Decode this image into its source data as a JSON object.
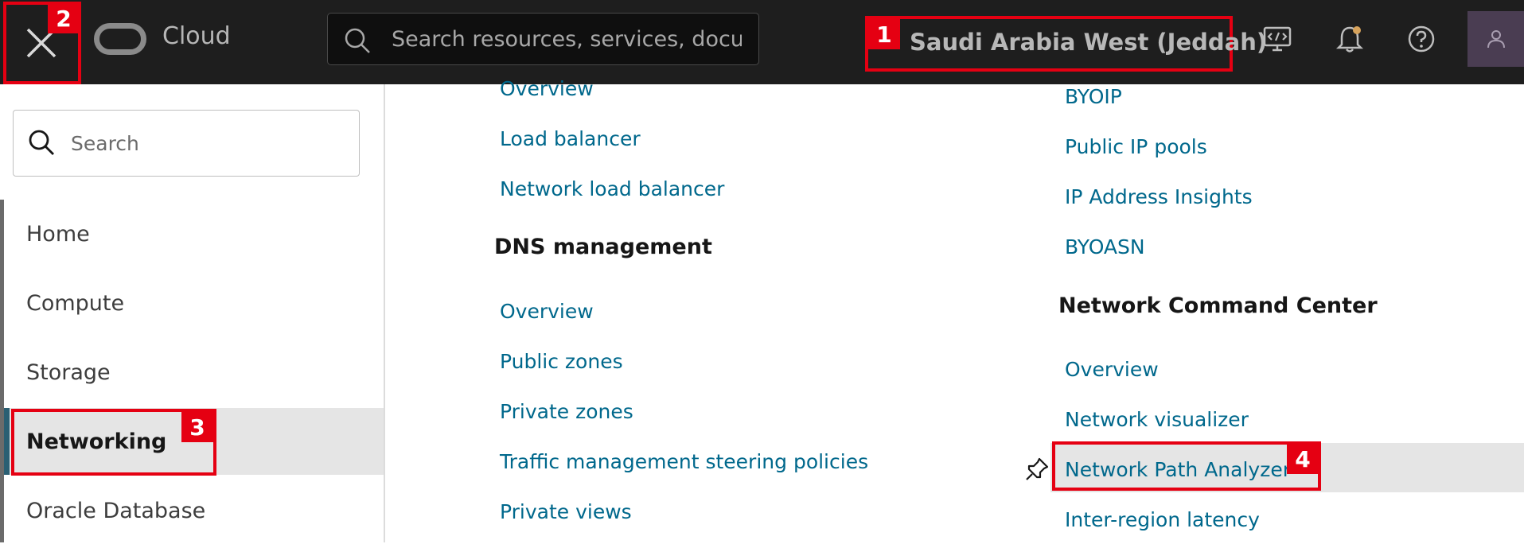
{
  "header": {
    "brand": "Cloud",
    "search_placeholder": "Search resources, services, docur",
    "region": "Saudi Arabia West (Jeddah)"
  },
  "sidebar": {
    "search_placeholder": "Search",
    "items": [
      {
        "label": "Home"
      },
      {
        "label": "Compute"
      },
      {
        "label": "Storage"
      },
      {
        "label": "Networking"
      },
      {
        "label": "Oracle Database"
      }
    ]
  },
  "col1": {
    "links_top": [
      "Overview",
      "Load balancer",
      "Network load balancer"
    ],
    "dns_heading": "DNS management",
    "dns_links": [
      "Overview",
      "Public zones",
      "Private zones",
      "Traffic management steering policies",
      "Private views"
    ]
  },
  "col2": {
    "links_top": [
      "BYOIP",
      "Public IP pools",
      "IP Address Insights",
      "BYOASN"
    ],
    "ncc_heading": "Network Command Center",
    "ncc_links": [
      "Overview",
      "Network visualizer",
      "Network Path Analyzer",
      "Inter-region latency"
    ]
  },
  "badges": [
    "1",
    "2",
    "3",
    "4"
  ],
  "colors": {
    "highlight": "#e50012",
    "link": "#00688c",
    "topbar": "#1e1e1e"
  }
}
